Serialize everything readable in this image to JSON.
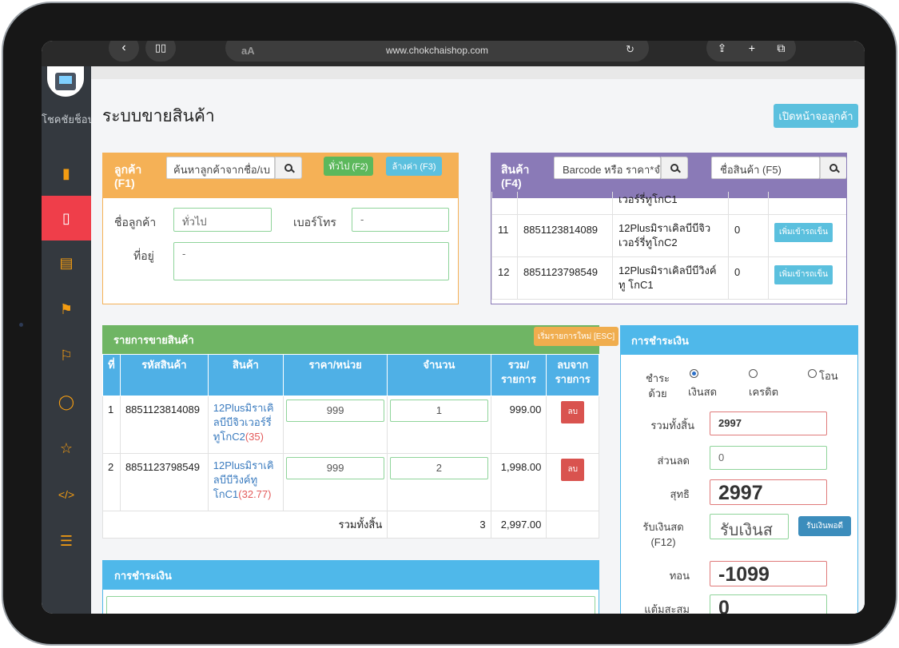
{
  "browser": {
    "url": "www.chokchaishop.com",
    "text_size_label": "aA"
  },
  "sidebar": {
    "brand": "โชคชัยช็อป",
    "items": [
      {
        "icon": "bookmark-filled-icon"
      },
      {
        "icon": "bookmark-outline-icon",
        "active": true
      },
      {
        "icon": "document-icon"
      },
      {
        "icon": "flag-icon"
      },
      {
        "icon": "flag-icon"
      },
      {
        "icon": "chat-icon"
      },
      {
        "icon": "star-icon"
      },
      {
        "icon": "code-icon"
      },
      {
        "icon": "sliders-icon"
      }
    ]
  },
  "header": {
    "title": "ระบบขายสินค้า",
    "open_customer_screen": "เปิดหน้าจอลูกค้า"
  },
  "customer": {
    "title_line1": "ลูกค้า",
    "title_line2": "(F1)",
    "search_placeholder": "ค้นหาลูกค้าจากชื่อ/เบ",
    "general_button": "ทั่วไป (F2)",
    "clear_button": "ล้างค่า (F3)",
    "name_label": "ชื่อลูกค้า",
    "name_value": "ทั่วไป",
    "phone_label": "เบอร์โทร",
    "phone_value": "-",
    "address_label": "ที่อยู่",
    "address_value": "-"
  },
  "product": {
    "title_line1": "สินค้า",
    "title_line2": "(F4)",
    "barcode_placeholder": "Barcode หรือ ราคา*จำ",
    "name_placeholder": "ชื่อสินค้า (F5)",
    "add_label": "เพิ่มเข้ารถเข็น",
    "rows": [
      {
        "no": "",
        "barcode": "",
        "name": "เวอร์รี่ทูโกC1",
        "stock": ""
      },
      {
        "no": "11",
        "barcode": "8851123814089",
        "name": "12Plusมิราเคิลบีบีจิว เวอร์รี่ทูโกC2",
        "stock": "0"
      },
      {
        "no": "12",
        "barcode": "8851123798549",
        "name": "12Plusมิราเคิลบีบีวิงค์ทู โกC1",
        "stock": "0"
      }
    ]
  },
  "sales": {
    "title": "รายการขายสินค้า",
    "new_list_button": "เริ่มรายการใหม่ [ESC]",
    "columns": [
      "ที่",
      "รหัสสินค้า",
      "สินค้า",
      "ราคา/หน่วย",
      "จำนวน",
      "รวม/ รายการ",
      "ลบจาก รายการ"
    ],
    "delete_label": "ลบ",
    "items": [
      {
        "no": "1",
        "code": "8851123814089",
        "name": "12Plusมิราเคิลบีบีจิวเวอร์รี่ทูโกC2",
        "stock": "(35)",
        "price": "999",
        "qty": "1",
        "total": "999.00"
      },
      {
        "no": "2",
        "code": "8851123798549",
        "name": "12Plusมิราเคิลบีบีวิงค์ทูโกC1",
        "stock": "(32.77)",
        "price": "999",
        "qty": "2",
        "total": "1,998.00"
      }
    ],
    "sum_label": "รวมทั้งสิ้น",
    "sum_qty": "3",
    "sum_total": "2,997.00"
  },
  "payment_bottom": {
    "title": "การชำระเงิน"
  },
  "payment": {
    "title": "การชำระเงิน",
    "method_label": "ชำระ ด้วย",
    "methods": [
      "เงินสด",
      "เครดิต",
      "โอน"
    ],
    "selected_method": "เงินสด",
    "total_label": "รวมทั้งสิ้น",
    "total_value": "2997",
    "discount_label": "ส่วนลด",
    "discount_value": "0",
    "net_label": "สุทธิ",
    "net_value": "2997",
    "cash_label": "รับเงินสด (F12)",
    "cash_placeholder": "รับเงินส",
    "exact_button": "รับเงินพอดี",
    "change_label": "ทอน",
    "change_value": "-1099",
    "cumulative_label": "แต้มสะสม",
    "cumulative_value": "0"
  },
  "colors": {
    "sidebar_bg": "#34393f",
    "sidebar_active": "#ef3e4a",
    "sidebar_icon": "#f39c12",
    "customer_header": "#f5b156",
    "product_header": "#8a7ab7",
    "sales_header": "#6fb564",
    "table_header": "#4fb0e6",
    "payment_header": "#4fb8ea"
  }
}
